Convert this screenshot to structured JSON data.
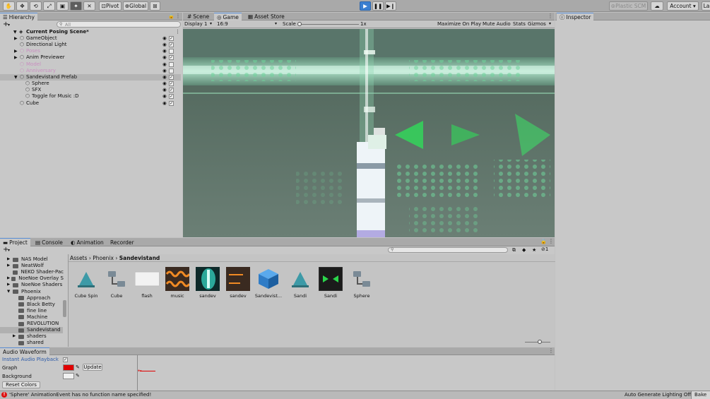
{
  "toolbar": {
    "pivot": "Pivot",
    "global": "Global",
    "plastic": "Plastic SCM",
    "account": "Account",
    "layers": "La"
  },
  "hierarchy": {
    "tab": "Hierarchy",
    "search_placeholder": "All",
    "scene": "Current Posing Scene*",
    "items": [
      {
        "label": "GameObject",
        "checked": true
      },
      {
        "label": "Directional Light",
        "checked": true
      },
      {
        "label": "Poses",
        "checked": false
      },
      {
        "label": "Anim Previewer",
        "checked": true
      },
      {
        "label": "Model",
        "checked": false
      },
      {
        "label": "Anniversary",
        "checked": false
      },
      {
        "label": "Sandevistand Prefab",
        "checked": true
      },
      {
        "label": "Sphere",
        "checked": true
      },
      {
        "label": "SFX",
        "checked": true
      },
      {
        "label": "Toggle for Music :D",
        "checked": true
      },
      {
        "label": "Cube",
        "checked": true
      }
    ]
  },
  "view": {
    "tabs": [
      "Scene",
      "Game",
      "Asset Store"
    ],
    "display": "Display 1",
    "aspect": "16:9",
    "scale_label": "Scale",
    "scale_value": "1x",
    "options": [
      "Maximize On Play",
      "Mute Audio",
      "Stats",
      "Gizmos"
    ]
  },
  "inspector": {
    "tab": "Inspector"
  },
  "project": {
    "tabs": [
      "Project",
      "Console",
      "Animation",
      "Recorder"
    ],
    "count_badge": "1",
    "folders": [
      {
        "label": "NAS Model",
        "indent": 1
      },
      {
        "label": "NeatWolf",
        "indent": 1
      },
      {
        "label": "NEKO Shader-Pac",
        "indent": 1
      },
      {
        "label": "NoeNoe Overlay S",
        "indent": 1
      },
      {
        "label": "NoeNoe Shaders",
        "indent": 1
      },
      {
        "label": "Phoenix",
        "indent": 1
      },
      {
        "label": "Approach",
        "indent": 2
      },
      {
        "label": "Black Betty",
        "indent": 2
      },
      {
        "label": "fine line",
        "indent": 2
      },
      {
        "label": "Machine",
        "indent": 2
      },
      {
        "label": "REVOLUTION",
        "indent": 2
      },
      {
        "label": "Sandevistand",
        "indent": 2
      },
      {
        "label": "shaders",
        "indent": 2
      },
      {
        "label": "shared",
        "indent": 2
      }
    ],
    "breadcrumb": [
      "Assets",
      "Phoenix",
      "Sandevistand"
    ],
    "assets": [
      "Cube Spin",
      "Cube",
      "flash",
      "music",
      "sandev",
      "sandev",
      "Sandevist...",
      "Sandi",
      "Sandi",
      "Sphere"
    ]
  },
  "audio_waveform": {
    "tab": "Audio Waveform",
    "instant_playback": "Instant Audio Playback",
    "graph": "Graph",
    "background": "Background",
    "update": "Update",
    "reset": "Reset Colors",
    "graph_color": "#e00000",
    "background_color": "#f0f0f0"
  },
  "status": {
    "message": "'Sphere' AnimationEvent has no function name specified!",
    "right": "Auto Generate Lighting Off",
    "bake": "Bake"
  }
}
